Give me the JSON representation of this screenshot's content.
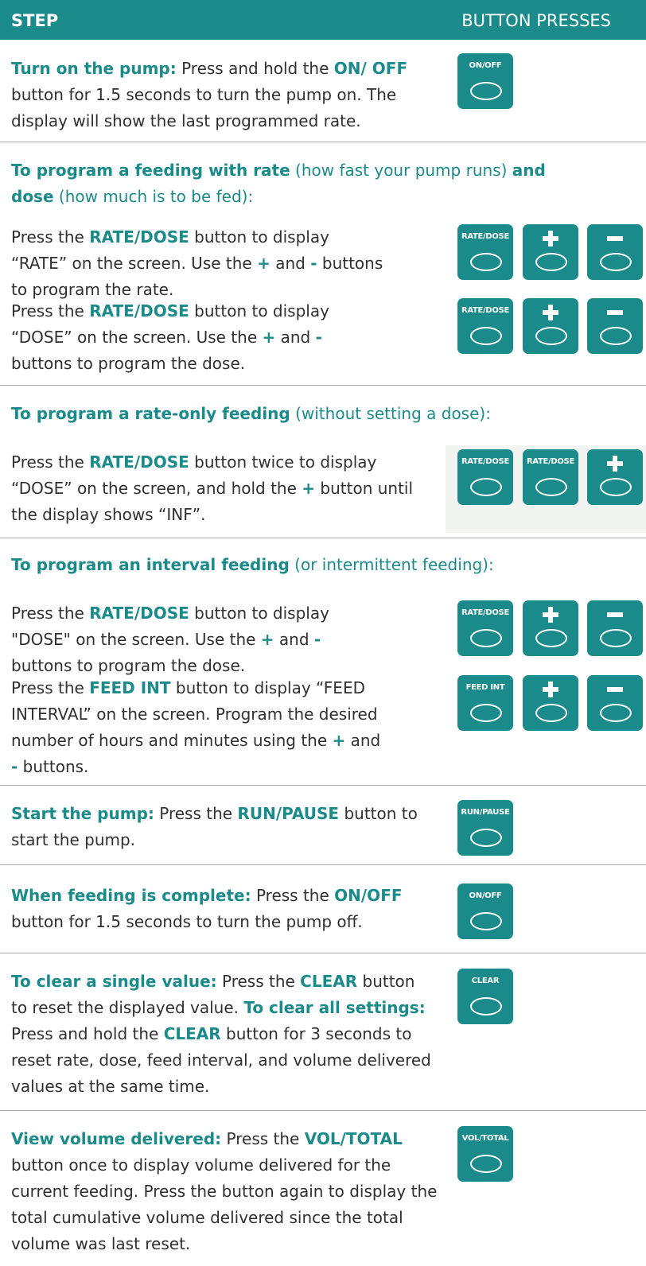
{
  "header": {
    "step": "STEP",
    "presses": "BUTTON PRESSES"
  },
  "on": {
    "b1": "Turn on the pump:",
    "t1": " Press and hold the ",
    "b2": "ON/ OFF",
    "t2": " button for 1.5 seconds to turn the pump on. The display will show the last programmed rate.",
    "btn": "ON/OFF"
  },
  "prog": {
    "b1": "To program a feeding with rate",
    "t1": " (how fast your pump runs) ",
    "b2": "and dose",
    "t2": " (how much is to be fed):",
    "r_t1": "Press the ",
    "r_b1": "RATE/DOSE",
    "r_t2": " button to display “RATE” on the screen. Use the ",
    "plus": "+",
    "and": " and ",
    "minus": "-",
    "r_t3": " buttons to program the rate.",
    "d_t1": "Press the ",
    "d_b1": "RATE/DOSE",
    "d_t2": " button to display “DOSE” on the screen. Use the ",
    "d_t3": " buttons to program the dose.",
    "btn_rate": "RATE/DOSE"
  },
  "rate_only": {
    "b1": "To program a rate-only feeding",
    "t1": " (without setting a dose):",
    "p_t1": "Press the ",
    "p_b1": "RATE/DOSE",
    "p_t2": " button twice to display “DOSE” on the screen, and hold the ",
    "plus": "+",
    "p_t3": " button until the display shows “INF”.",
    "btn_rate": "RATE/DOSE"
  },
  "interval": {
    "b1": "To program an interval feeding",
    "t1": " (or intermittent feeding):",
    "d_t1": "Press the ",
    "d_b1": "RATE/DOSE",
    "d_t2": " button to display \"DOSE\" on the screen. Use the ",
    "plus": "+",
    "and": " and ",
    "minus": "-",
    "d_t3": " buttons to program the dose.",
    "f_t1": "Press the ",
    "f_b1": "FEED INT",
    "f_t2": " button to display “FEED INTERVAL” on the screen. Program the desired number of hours and minutes using the ",
    "f_t3": " buttons.",
    "btn_rate": "RATE/DOSE",
    "btn_feed": "FEED INT"
  },
  "start": {
    "b1": "Start the pump:",
    "t1": " Press the ",
    "b2": "RUN/PAUSE",
    "t2": " button to start the pump.",
    "btn": "RUN/PAUSE"
  },
  "complete": {
    "b1": "When feeding is complete:",
    "t1": " Press the ",
    "b2": "ON/OFF",
    "t2": " button for 1.5 seconds to turn the pump off.",
    "btn": "ON/OFF"
  },
  "clear": {
    "b1": "To clear a single value:",
    "t1": " Press the ",
    "b2": "CLEAR",
    "t2": " button to reset the displayed value. ",
    "b3": "To clear all settings:",
    "t3": " Press and hold the ",
    "b4": "CLEAR",
    "t4": " button for 3 seconds to reset rate, dose, feed interval, and volume delivered values at the same time.",
    "btn": "CLEAR"
  },
  "volume": {
    "b1": "View volume delivered:",
    "t1": " Press the ",
    "b2": "VOL/TOTAL",
    "t2": " button once to display volume delivered for the current feeding. Press the button again to display the total cumulative volume delivered since the total volume was last reset.",
    "btn": "VOL/TOTAL"
  },
  "colors": {
    "teal": "#1b8a8a",
    "divider": "#a8a8a8",
    "text": "#303030"
  }
}
